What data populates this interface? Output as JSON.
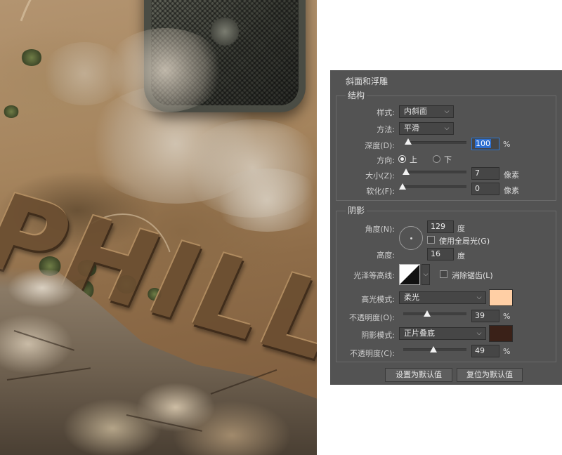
{
  "artwork": {
    "word": "PHILL"
  },
  "bevel": {
    "title": "斜面和浮雕",
    "structure": {
      "title": "结构",
      "style_label": "样式:",
      "style_value": "内斜面",
      "technique_label": "方法:",
      "technique_value": "平滑",
      "depth_label": "深度(D):",
      "depth_value": "100",
      "depth_unit": "%",
      "depth_percent": 100,
      "direction_label": "方向:",
      "direction_up": "上",
      "direction_down": "下",
      "direction_selected": "up",
      "size_label": "大小(Z):",
      "size_value": "7",
      "size_unit": "像素",
      "soften_label": "软化(F):",
      "soften_value": "0",
      "soften_unit": "像素"
    },
    "shading": {
      "title": "阴影",
      "angle_label": "角度(N):",
      "angle_value": "129",
      "angle_unit": "度",
      "global_light_label": "使用全局光(G)",
      "global_light_checked": false,
      "altitude_label": "高度:",
      "altitude_value": "16",
      "altitude_unit": "度",
      "gloss_label": "光泽等高线:",
      "antialias_label": "消除锯齿(L)",
      "antialias_checked": false,
      "highlight_mode_label": "高光模式:",
      "highlight_mode_value": "柔光",
      "highlight_color": "#ffcfa5",
      "highlight_opacity_label": "不透明度(O):",
      "highlight_opacity_value": "39",
      "highlight_opacity_unit": "%",
      "shadow_mode_label": "阴影模式:",
      "shadow_mode_value": "正片叠底",
      "shadow_color": "#3a2118",
      "shadow_opacity_label": "不透明度(C):",
      "shadow_opacity_value": "49",
      "shadow_opacity_unit": "%"
    },
    "buttons": {
      "make_default": "设置为默认值",
      "reset_default": "复位为默认值"
    }
  },
  "icons": {
    "dropdown": "chevron-down-icon",
    "contour": "contour-curve-icon",
    "angle": "angle-dial-icon"
  }
}
